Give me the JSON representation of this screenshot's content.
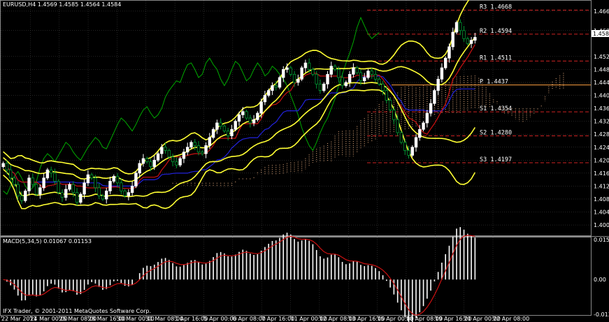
{
  "header": {
    "title": "EURUSD,H4  1.4569 1.4585 1.4564 1.4584"
  },
  "macd_label": "MACD(5,34,5) 0.01067 0.01153",
  "copyright": "IFX Trader, © 2001-2011 MetaQuotes Software Corp.",
  "current_price_tag": "1.4584",
  "colors": {
    "background": "#000000",
    "grid": "#4a4a4a",
    "candle_bull": "#ffffff",
    "candle_bear": "#009933",
    "bollinger": "#ffff33",
    "ma_red": "#cc1111",
    "ma_blue": "#2222dd",
    "chikou_green": "#00aa00",
    "cloud": "#c8966e",
    "pivot_red": "#cc2222",
    "pivot_orange": "#ffa040",
    "macd_hist": "#ffffff",
    "macd_signal": "#cc1111"
  },
  "pivots": [
    {
      "label": "R3  1.4668",
      "value": 1.4668,
      "kind": "r"
    },
    {
      "label": "R2  1.4594",
      "value": 1.4594,
      "kind": "r"
    },
    {
      "label": "R1  1.4511",
      "value": 1.4511,
      "kind": "r"
    },
    {
      "label": "P  1.4437",
      "value": 1.4437,
      "kind": "p"
    },
    {
      "label": "S1  1.4354",
      "value": 1.4354,
      "kind": "s"
    },
    {
      "label": "S2  1.4280",
      "value": 1.428,
      "kind": "s"
    },
    {
      "label": "S3  1.4197",
      "value": 1.4197,
      "kind": "s"
    }
  ],
  "chart_data": [
    {
      "type": "candlestick",
      "symbol": "EURUSD",
      "timeframe": "H4",
      "ylim": [
        1.3975,
        1.4695
      ],
      "yticks": [
        "1.4665",
        "1.4605",
        "1.4525",
        "1.4485",
        "1.4445",
        "1.4405",
        "1.4365",
        "1.4325",
        "1.4285",
        "1.4245",
        "1.4205",
        "1.4165",
        "1.4125",
        "1.4085",
        "1.4045",
        "1.4005"
      ],
      "x_labels": [
        "22 Mar 2011",
        "24 Mar 00:00",
        "25 Mar 08:00",
        "28 Mar 16:00",
        "30 Mar 00:00",
        "31 Mar 08:00",
        "1 Apr 16:00",
        "5 Apr 00:00",
        "6 Apr 08:00",
        "7 Apr 16:00",
        "11 Apr 00:00",
        "12 Apr 08:00",
        "13 Apr 16:00",
        "15 Apr 00:00",
        "18 Apr 08:00",
        "19 Apr 16:00",
        "21 Apr 00:00",
        "22 Apr 08:00"
      ],
      "close_series": [
        1.4195,
        1.4175,
        1.415,
        1.413,
        1.4095,
        1.408,
        1.411,
        1.415,
        1.413,
        1.41,
        1.412,
        1.415,
        1.4175,
        1.4165,
        1.414,
        1.4105,
        1.409,
        1.4115,
        1.413,
        1.4105,
        1.4075,
        1.41,
        1.4135,
        1.416,
        1.415,
        1.412,
        1.4095,
        1.4085,
        1.411,
        1.414,
        1.4155,
        1.4135,
        1.411,
        1.4095,
        1.4105,
        1.4125,
        1.4165,
        1.4195,
        1.421,
        1.42,
        1.4185,
        1.4205,
        1.4225,
        1.4245,
        1.4235,
        1.4215,
        1.42,
        1.419,
        1.421,
        1.423,
        1.4245,
        1.426,
        1.425,
        1.423,
        1.4225,
        1.425,
        1.4275,
        1.43,
        1.432,
        1.431,
        1.4295,
        1.428,
        1.43,
        1.4325,
        1.4345,
        1.4355,
        1.4335,
        1.432,
        1.433,
        1.435,
        1.4385,
        1.4405,
        1.442,
        1.4435,
        1.443,
        1.446,
        1.4485,
        1.449,
        1.447,
        1.4445,
        1.4455,
        1.449,
        1.4505,
        1.4485,
        1.447,
        1.444,
        1.442,
        1.444,
        1.447,
        1.4495,
        1.4485,
        1.446,
        1.4435,
        1.4445,
        1.447,
        1.449,
        1.4475,
        1.445,
        1.446,
        1.448,
        1.447,
        1.4455,
        1.444,
        1.442,
        1.439,
        1.436,
        1.433,
        1.429,
        1.426,
        1.4235,
        1.422,
        1.4245,
        1.4275,
        1.43,
        1.432,
        1.435,
        1.438,
        1.442,
        1.4455,
        1.449,
        1.452,
        1.4555,
        1.46,
        1.463,
        1.4605,
        1.458,
        1.4565,
        1.4575,
        1.4584
      ],
      "macd": {
        "label": "MACD(5,34,5)",
        "main": 0.01067,
        "signal": 0.01153,
        "yticks": [
          "0.01538",
          "0.00",
          "-0.01337"
        ]
      }
    }
  ]
}
